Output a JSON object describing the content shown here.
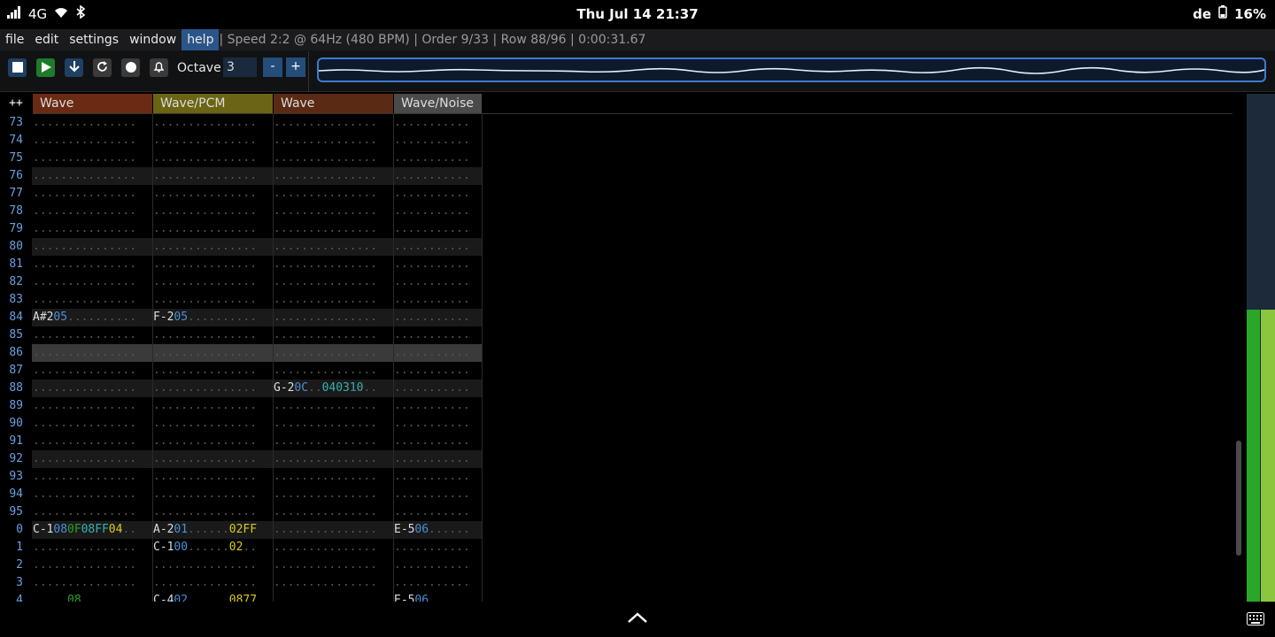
{
  "status_bar": {
    "network": "4G",
    "datetime": "Thu Jul 14  21:37",
    "keyboard_layout": "de",
    "battery": "16%"
  },
  "menu": {
    "items": [
      "file",
      "edit",
      "settings",
      "window",
      "help"
    ],
    "active": "help",
    "status": "| Speed 2:2 @ 64Hz (480 BPM) | Order 9/33 | Row 88/96 | 0:00:31.67"
  },
  "toolbar": {
    "octave_label": "Octave",
    "octave_value": "3",
    "minus_label": "-",
    "plus_label": "+"
  },
  "pattern": {
    "corner_label": "++",
    "channels": [
      {
        "name": "Wave",
        "color": "#6b2a14"
      },
      {
        "name": "Wave/PCM",
        "color": "#6b6414"
      },
      {
        "name": "Wave",
        "color": "#5a2a14"
      },
      {
        "name": "Wave/Noise",
        "color": "#4a4a4a"
      }
    ],
    "colors": {
      "note": "#dddddd",
      "instrument": "#4a90d9",
      "volume": "#2aa02a",
      "effect": "#d8c820",
      "effect_val": "#38b0b0",
      "dots": "#555555",
      "row_number": "#6aa0e0",
      "highlight_row": "#1a1a1a",
      "cursor_row": "#3a3a3a"
    },
    "rows": [
      {
        "num": "73",
        "hl": false,
        "cells": [
          [],
          [],
          [],
          []
        ]
      },
      {
        "num": "74",
        "hl": false,
        "cells": [
          [],
          [],
          [],
          []
        ]
      },
      {
        "num": "75",
        "hl": false,
        "cells": [
          [],
          [],
          [],
          []
        ]
      },
      {
        "num": "76",
        "hl": true,
        "cells": [
          [],
          [],
          [],
          []
        ]
      },
      {
        "num": "77",
        "hl": false,
        "cells": [
          [],
          [],
          [],
          []
        ]
      },
      {
        "num": "78",
        "hl": false,
        "cells": [
          [],
          [],
          [],
          []
        ]
      },
      {
        "num": "79",
        "hl": false,
        "cells": [
          [],
          [],
          [],
          []
        ]
      },
      {
        "num": "80",
        "hl": true,
        "cells": [
          [],
          [],
          [],
          []
        ]
      },
      {
        "num": "81",
        "hl": false,
        "cells": [
          [],
          [],
          [],
          []
        ]
      },
      {
        "num": "82",
        "hl": false,
        "cells": [
          [],
          [],
          [],
          []
        ]
      },
      {
        "num": "83",
        "hl": false,
        "cells": [
          [],
          [],
          [],
          []
        ]
      },
      {
        "num": "84",
        "hl": true,
        "cells": [
          [
            "A#2",
            "05"
          ],
          [
            "F-2",
            "05"
          ],
          [],
          []
        ]
      },
      {
        "num": "85",
        "hl": false,
        "cells": [
          [],
          [],
          [],
          []
        ]
      },
      {
        "num": "86",
        "hl": "cursor",
        "cells": [
          [],
          [],
          [],
          []
        ]
      },
      {
        "num": "87",
        "hl": false,
        "cells": [
          [],
          [],
          [],
          []
        ]
      },
      {
        "num": "88",
        "hl": true,
        "cells": [
          [],
          [],
          [
            "G-2",
            "0C",
            "",
            "04",
            "0310"
          ],
          []
        ]
      },
      {
        "num": "89",
        "hl": false,
        "cells": [
          [],
          [],
          [],
          []
        ]
      },
      {
        "num": "90",
        "hl": false,
        "cells": [
          [],
          [],
          [],
          []
        ]
      },
      {
        "num": "91",
        "hl": false,
        "cells": [
          [],
          [],
          [],
          []
        ]
      },
      {
        "num": "92",
        "hl": true,
        "cells": [
          [],
          [],
          [],
          []
        ]
      },
      {
        "num": "93",
        "hl": false,
        "cells": [
          [],
          [],
          [],
          []
        ]
      },
      {
        "num": "94",
        "hl": false,
        "cells": [
          [],
          [],
          [],
          []
        ]
      },
      {
        "num": "95",
        "hl": false,
        "cells": [
          [],
          [],
          [],
          []
        ]
      },
      {
        "num": "0",
        "hl": true,
        "cells": [
          [
            "C-1",
            "08",
            "0F",
            "08",
            "FF",
            "04",
            ".."
          ],
          [
            "A-2",
            "01",
            "",
            "",
            "",
            "02",
            "FF"
          ],
          [],
          [
            "E-5",
            "06"
          ]
        ]
      },
      {
        "num": "1",
        "hl": false,
        "cells": [
          [],
          [
            "C-1",
            "00",
            "",
            "",
            "",
            "02",
            ".."
          ],
          [],
          []
        ]
      },
      {
        "num": "2",
        "hl": false,
        "cells": [
          [],
          [],
          [],
          []
        ]
      },
      {
        "num": "3",
        "hl": false,
        "cells": [
          [],
          [],
          [],
          []
        ]
      },
      {
        "num": "4",
        "hl": false,
        "cells": [
          [
            "...",
            "..",
            "08"
          ],
          [
            "C-4",
            "02",
            "",
            "",
            "",
            "08",
            "77"
          ],
          [],
          [
            "E-5",
            "06"
          ]
        ]
      }
    ]
  }
}
